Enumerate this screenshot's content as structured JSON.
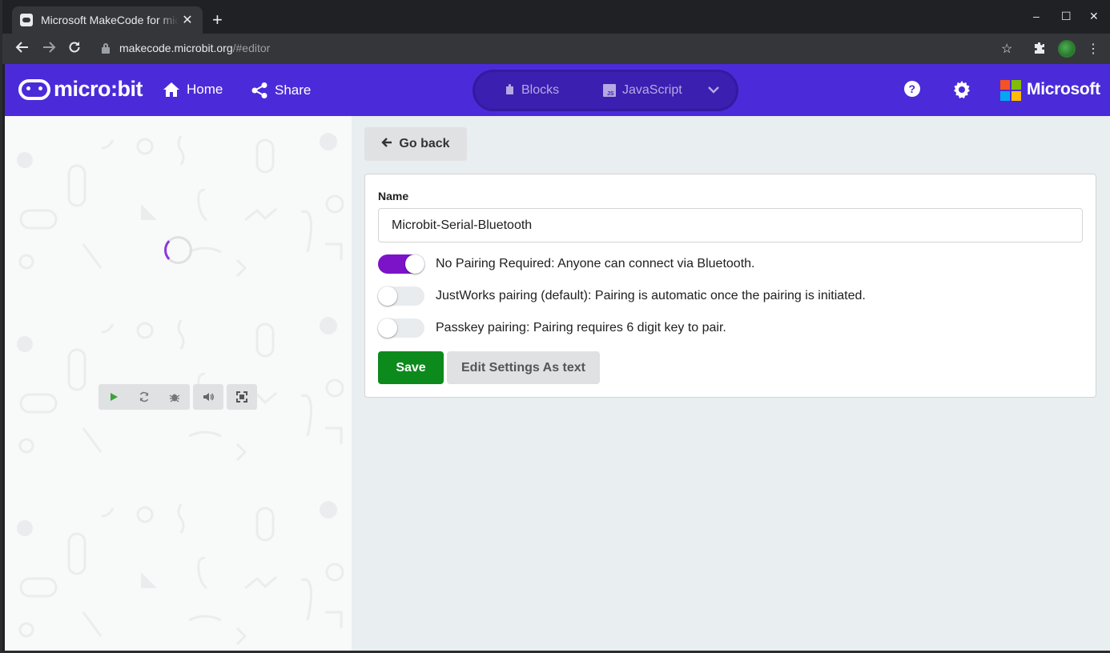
{
  "browser": {
    "tab_title": "Microsoft MakeCode for micro:bit",
    "tab_close": "✕",
    "new_tab": "+",
    "url_host": "makecode.microbit.org",
    "url_path": "/#editor",
    "window_controls": {
      "minimize": "–",
      "maximize": "☐",
      "close": "✕"
    }
  },
  "header": {
    "brand": "micro:bit",
    "home_label": "Home",
    "share_label": "Share",
    "modes": {
      "blocks": "Blocks",
      "javascript": "JavaScript"
    },
    "microsoft": "Microsoft",
    "colors": {
      "header_bg": "#4b2bd9",
      "toggle_bg": "#3a1fb0"
    }
  },
  "simulator": {
    "controls": [
      "play-icon",
      "restart-icon",
      "debug-icon",
      "mute-icon",
      "fullscreen-icon"
    ]
  },
  "settings": {
    "go_back": "Go back",
    "name_label": "Name",
    "name_value": "Microbit-Serial-Bluetooth",
    "options": [
      {
        "label": "No Pairing Required: Anyone can connect via Bluetooth.",
        "on": true
      },
      {
        "label": "JustWorks pairing (default): Pairing is automatic once the pairing is initiated.",
        "on": false
      },
      {
        "label": "Passkey pairing: Pairing requires 6 digit key to pair.",
        "on": false
      }
    ],
    "save": "Save",
    "edit_as_text": "Edit Settings As text",
    "colors": {
      "toggle_on": "#7c13c9",
      "save": "#0c8a1c"
    }
  }
}
